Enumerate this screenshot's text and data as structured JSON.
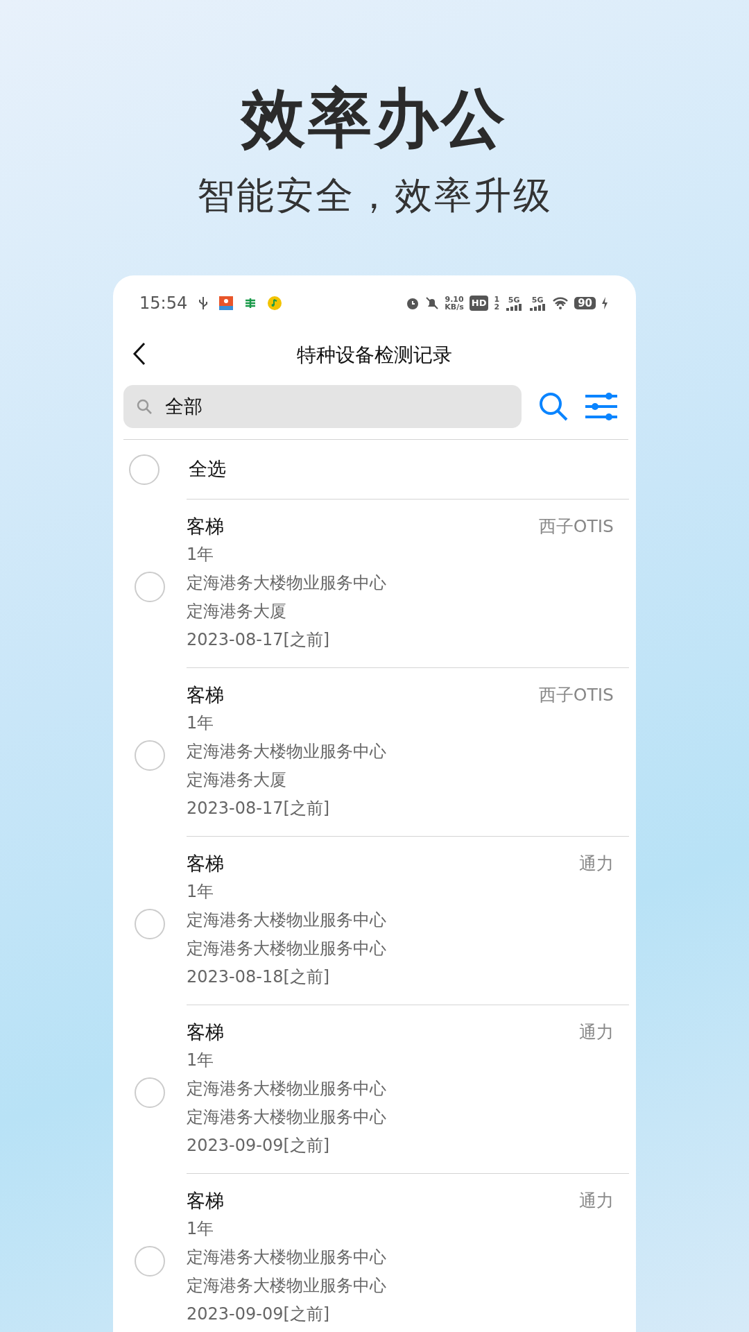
{
  "promo": {
    "title": "效率办公",
    "subtitle": "智能安全，效率升级"
  },
  "status_bar": {
    "time": "15:54",
    "speed_value": "9.10",
    "speed_unit": "KB/s",
    "hd": "HD",
    "hd_sup": "1",
    "hd_sub": "2",
    "sim1": "5G",
    "sim2": "5G",
    "battery": "90"
  },
  "nav": {
    "title": "特种设备检测记录"
  },
  "search": {
    "value": "全部"
  },
  "select_all": {
    "label": "全选",
    "checked": false
  },
  "items": [
    {
      "title": "客梯",
      "brand": "西子OTIS",
      "cycle": "1年",
      "unit": "定海港务大楼物业服务中心",
      "location": "定海港务大厦",
      "date": "2023-08-17[之前]",
      "checked": false
    },
    {
      "title": "客梯",
      "brand": "西子OTIS",
      "cycle": "1年",
      "unit": "定海港务大楼物业服务中心",
      "location": "定海港务大厦",
      "date": "2023-08-17[之前]",
      "checked": false
    },
    {
      "title": "客梯",
      "brand": "通力",
      "cycle": "1年",
      "unit": "定海港务大楼物业服务中心",
      "location": "定海港务大楼物业服务中心",
      "date": "2023-08-18[之前]",
      "checked": false
    },
    {
      "title": "客梯",
      "brand": "通力",
      "cycle": "1年",
      "unit": "定海港务大楼物业服务中心",
      "location": "定海港务大楼物业服务中心",
      "date": "2023-09-09[之前]",
      "checked": false
    },
    {
      "title": "客梯",
      "brand": "通力",
      "cycle": "1年",
      "unit": "定海港务大楼物业服务中心",
      "location": "定海港务大楼物业服务中心",
      "date": "2023-09-09[之前]",
      "checked": false
    }
  ]
}
